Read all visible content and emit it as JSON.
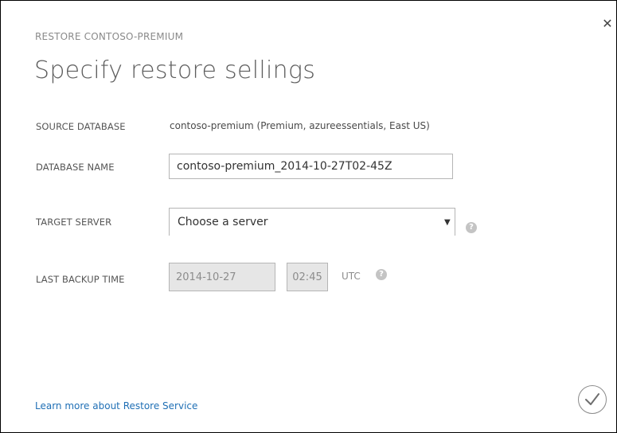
{
  "dialog": {
    "close_icon": "close-icon",
    "eyebrow": "RESTORE CONTOSO-PREMIUM",
    "title": "Specify restore sellings"
  },
  "fields": {
    "source_database": {
      "label": "SOURCE DATABASE",
      "value": "contoso-premium (Premium, azureessentials, East US)"
    },
    "database_name": {
      "label": "DATABASE NAME",
      "value": "contoso-premium_2014-10-27T02-45Z"
    },
    "target_server": {
      "label": "TARGET SERVER",
      "selected": "Choose a server",
      "help_icon": "help-icon"
    },
    "last_backup_time": {
      "label": "LAST BACKUP TIME",
      "date": "2014-10-27",
      "time": "02:45",
      "timezone": "UTC",
      "help_icon": "help-icon"
    }
  },
  "footer": {
    "learn_more": "Learn more about Restore Service",
    "confirm_icon": "checkmark-icon"
  },
  "colors": {
    "link": "#1f6fb5",
    "label": "#555555",
    "disabled_bg": "#e6e6e6"
  }
}
